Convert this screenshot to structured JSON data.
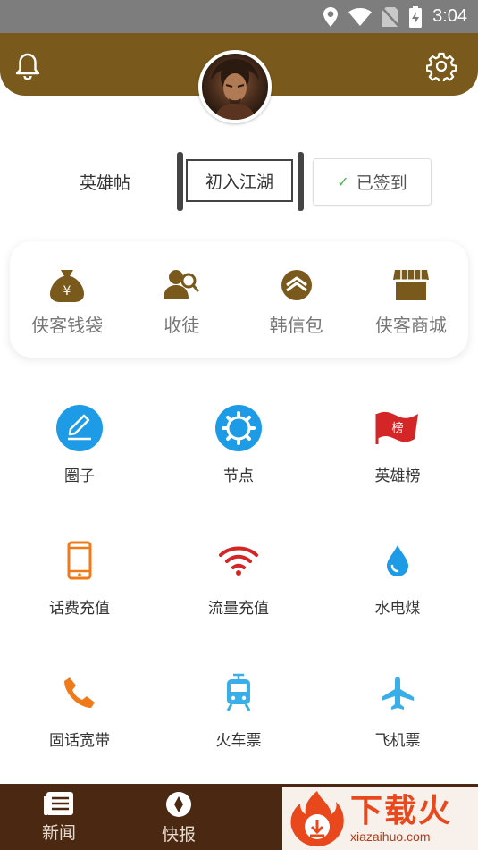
{
  "status_bar": {
    "time": "3:04",
    "icons": [
      "location-icon",
      "wifi-icon",
      "no-sim-icon",
      "battery-charging-icon"
    ]
  },
  "header": {
    "left_icon": "bell-icon",
    "right_icon": "gear-icon",
    "brand_color": "#7a5a1c"
  },
  "rank": {
    "label": "英雄帖",
    "title": "初入江湖",
    "sign_status": "已签到"
  },
  "quick_actions": [
    {
      "label": "侠客钱袋",
      "icon": "money-bag-icon"
    },
    {
      "label": "收徒",
      "icon": "apprentice-icon"
    },
    {
      "label": "韩信包",
      "icon": "wallet-icon"
    },
    {
      "label": "侠客商城",
      "icon": "shop-icon"
    }
  ],
  "services": [
    {
      "label": "圈子",
      "icon": "pencil-circle-icon"
    },
    {
      "label": "节点",
      "icon": "gear-circle-icon"
    },
    {
      "label": "英雄榜",
      "icon": "flag-icon"
    },
    {
      "label": "话费充值",
      "icon": "phone-icon"
    },
    {
      "label": "流量充值",
      "icon": "wifi-signal-icon"
    },
    {
      "label": "水电煤",
      "icon": "water-drop-icon"
    },
    {
      "label": "固话宽带",
      "icon": "telephone-icon"
    },
    {
      "label": "火车票",
      "icon": "train-icon"
    },
    {
      "label": "飞机票",
      "icon": "airplane-icon"
    }
  ],
  "bottom_nav": [
    {
      "label": "新闻",
      "icon": "news-icon"
    },
    {
      "label": "快报",
      "icon": "compass-icon"
    }
  ],
  "watermark": {
    "title": "下载火",
    "subtitle": "xiazaihuo.com"
  }
}
